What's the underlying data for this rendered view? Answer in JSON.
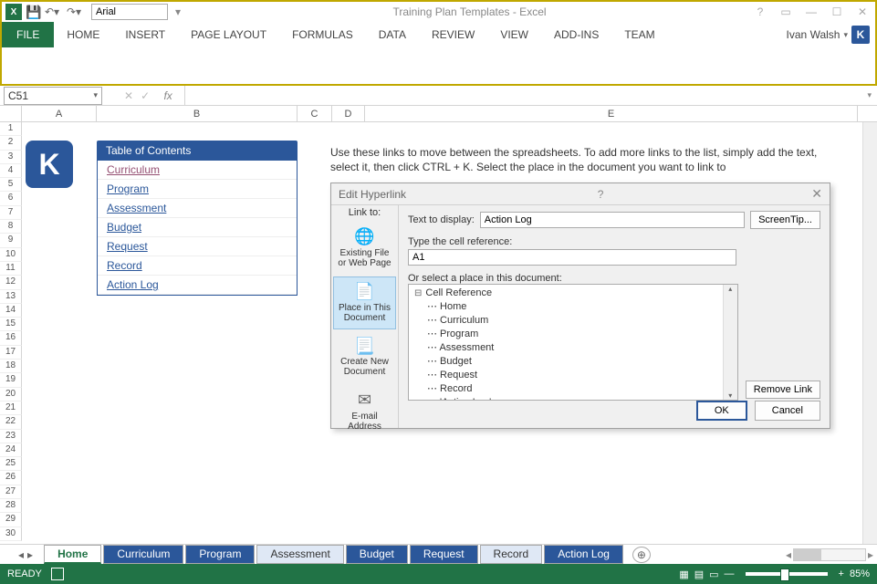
{
  "titlebar": {
    "font": "Arial",
    "title": "Training Plan Templates - Excel"
  },
  "ribbon": {
    "tabs": [
      "FILE",
      "HOME",
      "INSERT",
      "PAGE LAYOUT",
      "FORMULAS",
      "DATA",
      "REVIEW",
      "VIEW",
      "ADD-INS",
      "TEAM"
    ],
    "user": "Ivan Walsh",
    "user_initial": "K"
  },
  "formula": {
    "namebox": "C51",
    "fx": "fx"
  },
  "columns": [
    "A",
    "B",
    "C",
    "D",
    "E"
  ],
  "rows_count": 30,
  "logo_letter": "K",
  "toc": {
    "header": "Table of Contents",
    "items": [
      {
        "label": "Curriculum",
        "visited": true
      },
      {
        "label": "Program"
      },
      {
        "label": "Assessment"
      },
      {
        "label": "Budget"
      },
      {
        "label": "Request"
      },
      {
        "label": "Record"
      },
      {
        "label": "Action Log"
      }
    ]
  },
  "instructions": "Use these links to move between the spreadsheets. To add more links to the list, simply add the text, select it, then click CTRL + K. Select the place in the document you want to link to",
  "dialog": {
    "title": "Edit Hyperlink",
    "link_to_label": "Link to:",
    "text_label": "Text to display:",
    "text_value": "Action Log",
    "screentip": "ScreenTip...",
    "cellref_label": "Type the cell reference:",
    "cellref_value": "A1",
    "place_label": "Or select a place in this document:",
    "side": [
      {
        "label": "Existing File or Web Page",
        "icon": "🌐"
      },
      {
        "label": "Place in This Document",
        "icon": "📄",
        "selected": true
      },
      {
        "label": "Create New Document",
        "icon": "📃"
      },
      {
        "label": "E-mail Address",
        "icon": "✉"
      }
    ],
    "tree_root": "Cell Reference",
    "tree_items": [
      "Home",
      "Curriculum",
      "Program",
      "Assessment",
      "Budget",
      "Request",
      "Record",
      "'Action Log'"
    ],
    "remove": "Remove Link",
    "ok": "OK",
    "cancel": "Cancel"
  },
  "sheets": [
    {
      "name": "Home",
      "active": true
    },
    {
      "name": "Curriculum"
    },
    {
      "name": "Program"
    },
    {
      "name": "Assessment",
      "light": true
    },
    {
      "name": "Budget"
    },
    {
      "name": "Request"
    },
    {
      "name": "Record",
      "light": true
    },
    {
      "name": "Action Log"
    }
  ],
  "status": {
    "ready": "READY",
    "zoom": "85%"
  }
}
